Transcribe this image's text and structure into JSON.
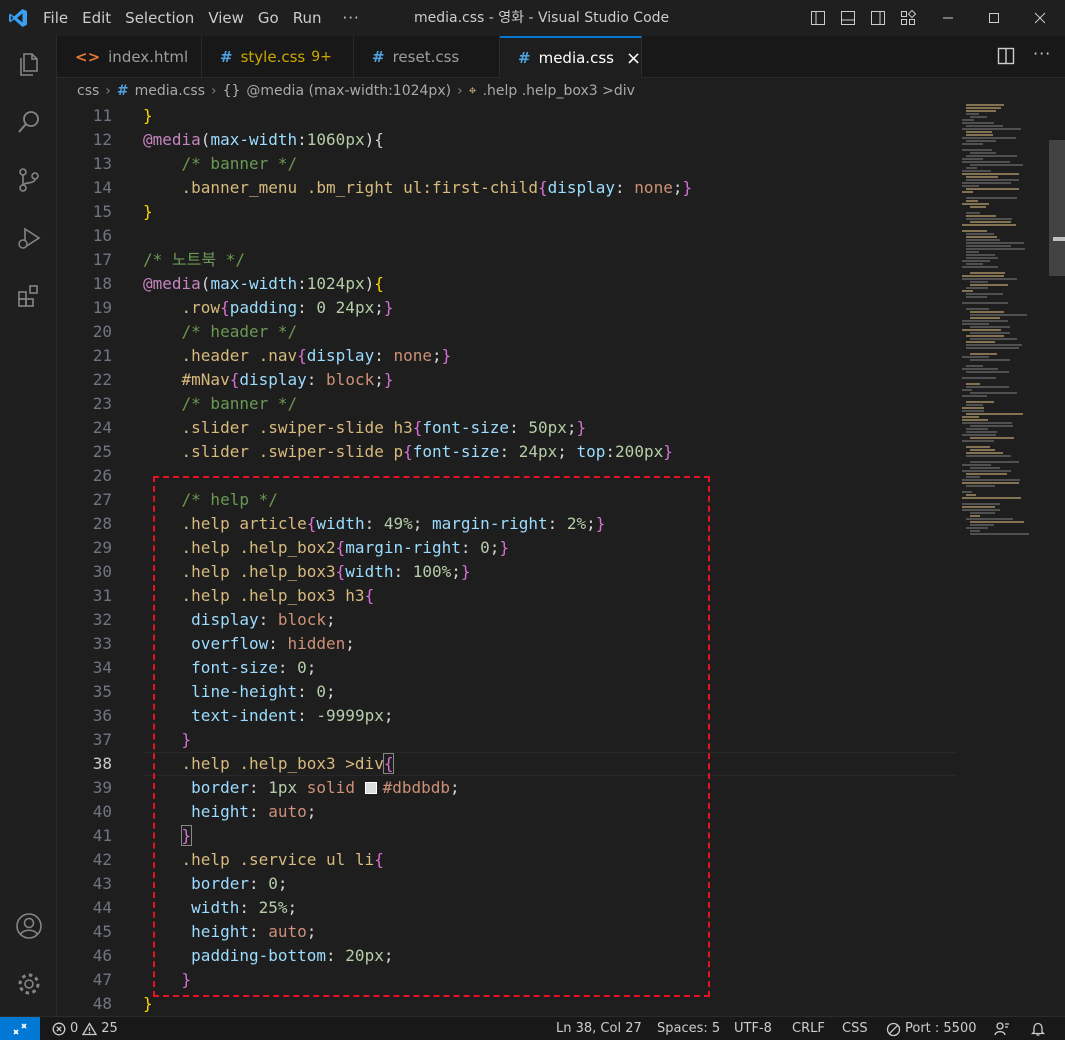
{
  "window": {
    "title": "media.css - 영화 - Visual Studio Code",
    "menu": [
      "File",
      "Edit",
      "Selection",
      "View",
      "Go",
      "Run"
    ],
    "menu_more": "···"
  },
  "tabs": [
    {
      "label": "index.html",
      "icon": "html-file-icon"
    },
    {
      "label": "style.css",
      "badge": "9+",
      "icon": "css-file-icon"
    },
    {
      "label": "reset.css",
      "icon": "css-file-icon"
    },
    {
      "label": "media.css",
      "icon": "css-file-icon",
      "active": true
    }
  ],
  "breadcrumb": {
    "folder": "css",
    "file": "media.css",
    "scope": "@media (max-width:1024px)",
    "selector": ".help .help_box3 >div"
  },
  "editor": {
    "current_line": 38,
    "swatch_color": "#dbdbdb",
    "lines": [
      11,
      12,
      13,
      14,
      15,
      16,
      17,
      18,
      19,
      20,
      21,
      22,
      23,
      24,
      25,
      26,
      27,
      28,
      29,
      30,
      31,
      32,
      33,
      34,
      35,
      36,
      37,
      38,
      39,
      40,
      41,
      42,
      43,
      44,
      45,
      46,
      47,
      48
    ]
  },
  "statusbar": {
    "errors": "0",
    "warnings": "25",
    "position": "Ln 38, Col 27",
    "spaces": "Spaces: 5",
    "encoding": "UTF-8",
    "eol": "CRLF",
    "language": "CSS",
    "port": "Port : 5500"
  },
  "colors": {
    "accent": "#0078d4",
    "highlight_border": "#e81123"
  }
}
